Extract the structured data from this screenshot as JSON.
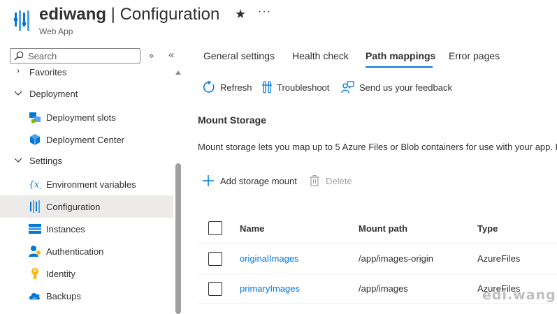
{
  "header": {
    "app_name": "ediwang",
    "separator": " | ",
    "page": "Configuration",
    "subtitle": "Web App",
    "favorite_glyph": "★",
    "more_glyph": "···"
  },
  "sidebar": {
    "search_placeholder": "Search",
    "sort_glyph": "⋄",
    "collapse_glyph": "«",
    "partial_item": "Favorites",
    "groups": [
      {
        "label": "Deployment",
        "expanded": true
      },
      {
        "label": "Settings",
        "expanded": true
      }
    ],
    "items": [
      {
        "label": "Deployment slots",
        "icon": "deployment-slots-icon"
      },
      {
        "label": "Deployment Center",
        "icon": "deployment-center-icon"
      },
      {
        "label": "Environment variables",
        "icon": "environment-variables-icon"
      },
      {
        "label": "Configuration",
        "icon": "configuration-icon",
        "selected": true
      },
      {
        "label": "Instances",
        "icon": "instances-icon"
      },
      {
        "label": "Authentication",
        "icon": "authentication-icon"
      },
      {
        "label": "Identity",
        "icon": "identity-icon"
      },
      {
        "label": "Backups",
        "icon": "backups-icon"
      }
    ],
    "selected_bg": "#edebe9"
  },
  "tabs": [
    {
      "label": "General settings"
    },
    {
      "label": "Health check"
    },
    {
      "label": "Path mappings",
      "active": true
    },
    {
      "label": "Error pages"
    }
  ],
  "toolbar": {
    "refresh": "Refresh",
    "troubleshoot": "Troubleshoot",
    "feedback": "Send us your feedback"
  },
  "section": {
    "title": "Mount Storage",
    "description": "Mount storage lets you map up to 5 Azure Files or Blob containers for use with your app. L"
  },
  "commands": {
    "add": "Add storage mount",
    "delete": "Delete"
  },
  "table": {
    "headers": {
      "name": "Name",
      "path": "Mount path",
      "type": "Type"
    },
    "rows": [
      {
        "name": "originalImages",
        "path": "/app/images-origin",
        "type": "AzureFiles"
      },
      {
        "name": "primaryImages",
        "path": "/app/images",
        "type": "AzureFiles"
      }
    ]
  },
  "watermark": "edi.wang",
  "colors": {
    "accent": "#0078d4",
    "text": "#323130",
    "muted": "#605e5c",
    "disabled": "#a19f9d"
  }
}
